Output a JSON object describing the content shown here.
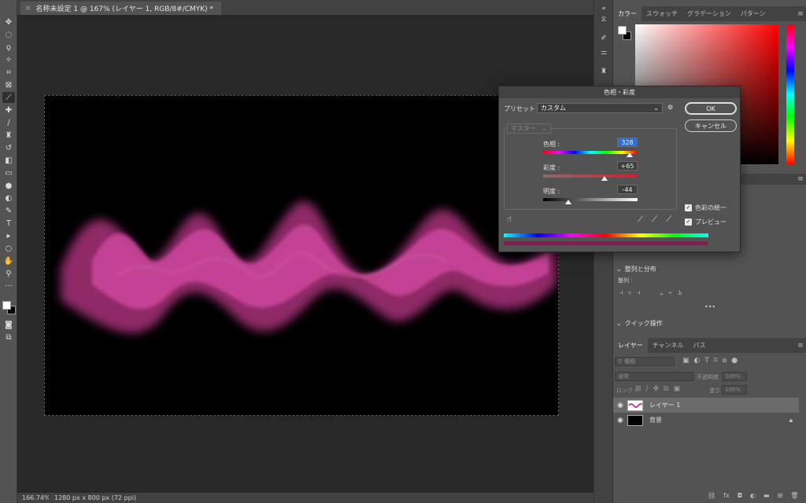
{
  "document": {
    "tab_close": "×",
    "tab_title": "名称未設定 1 @ 167% (レイヤー 1, RGB/8#/CMYK) *"
  },
  "status": {
    "zoom": "166.74%",
    "dimensions": "1280 px x 800 px (72 ppi)"
  },
  "tools": [
    {
      "icon": "move-icon",
      "glyph": "✥"
    },
    {
      "icon": "marquee-icon",
      "glyph": "◌"
    },
    {
      "icon": "lasso-icon",
      "glyph": "ϙ"
    },
    {
      "icon": "magic-wand-icon",
      "glyph": "✧"
    },
    {
      "icon": "crop-icon",
      "glyph": "⌗"
    },
    {
      "icon": "frame-icon",
      "glyph": "⊠"
    },
    {
      "icon": "eyedropper-icon",
      "glyph": "⟋"
    },
    {
      "icon": "healing-brush-icon",
      "glyph": "✚"
    },
    {
      "icon": "brush-icon",
      "glyph": "∕"
    },
    {
      "icon": "stamp-icon",
      "glyph": "♜"
    },
    {
      "icon": "history-brush-icon",
      "glyph": "↺"
    },
    {
      "icon": "eraser-icon",
      "glyph": "◧"
    },
    {
      "icon": "gradient-icon",
      "glyph": "▭"
    },
    {
      "icon": "blur-icon",
      "glyph": "●"
    },
    {
      "icon": "dodge-icon",
      "glyph": "◐"
    },
    {
      "icon": "pen-icon",
      "glyph": "✎"
    },
    {
      "icon": "type-icon",
      "glyph": "T"
    },
    {
      "icon": "path-select-icon",
      "glyph": "▸"
    },
    {
      "icon": "ellipse-icon",
      "glyph": "○"
    },
    {
      "icon": "hand-icon",
      "glyph": "✋"
    },
    {
      "icon": "zoom-icon",
      "glyph": "⚲"
    },
    {
      "icon": "more-tools-icon",
      "glyph": "···"
    }
  ],
  "color_panel": {
    "tabs": [
      "カラー",
      "スウォッチ",
      "グラデーション",
      "パターン"
    ],
    "active_tab": 0
  },
  "align_panel": {
    "title": "整列と分布",
    "align_label": "整列 :",
    "more": "•••"
  },
  "quick_actions": {
    "title": "クイック操作"
  },
  "layers_panel": {
    "tabs": [
      "レイヤー",
      "チャンネル",
      "パス"
    ],
    "active_tab": 0,
    "filter_placeholder": "種類",
    "blend_mode": "通常",
    "opacity_label": "不透明度 :",
    "opacity_value": "100%",
    "lock_label": "ロック :",
    "fill_label": "塗り :",
    "fill_value": "100%",
    "layers": [
      {
        "name": "レイヤー 1",
        "visible": true,
        "selected": true,
        "locked": false
      },
      {
        "name": "背景",
        "visible": true,
        "selected": false,
        "locked": true
      }
    ]
  },
  "dialog": {
    "title": "色相・彩度",
    "preset_label": "プリセット :",
    "preset_value": "カスタム",
    "channel_value": "マスター",
    "ok_label": "OK",
    "cancel_label": "キャンセル",
    "hue_label": "色相 :",
    "hue_value": "328",
    "saturation_label": "彩度 :",
    "saturation_value": "+65",
    "lightness_label": "明度 :",
    "lightness_value": "-44",
    "colorize_label": "色彩の統一",
    "colorize_checked": true,
    "preview_label": "プレビュー",
    "preview_checked": true,
    "result_color": "#8a1a52"
  }
}
